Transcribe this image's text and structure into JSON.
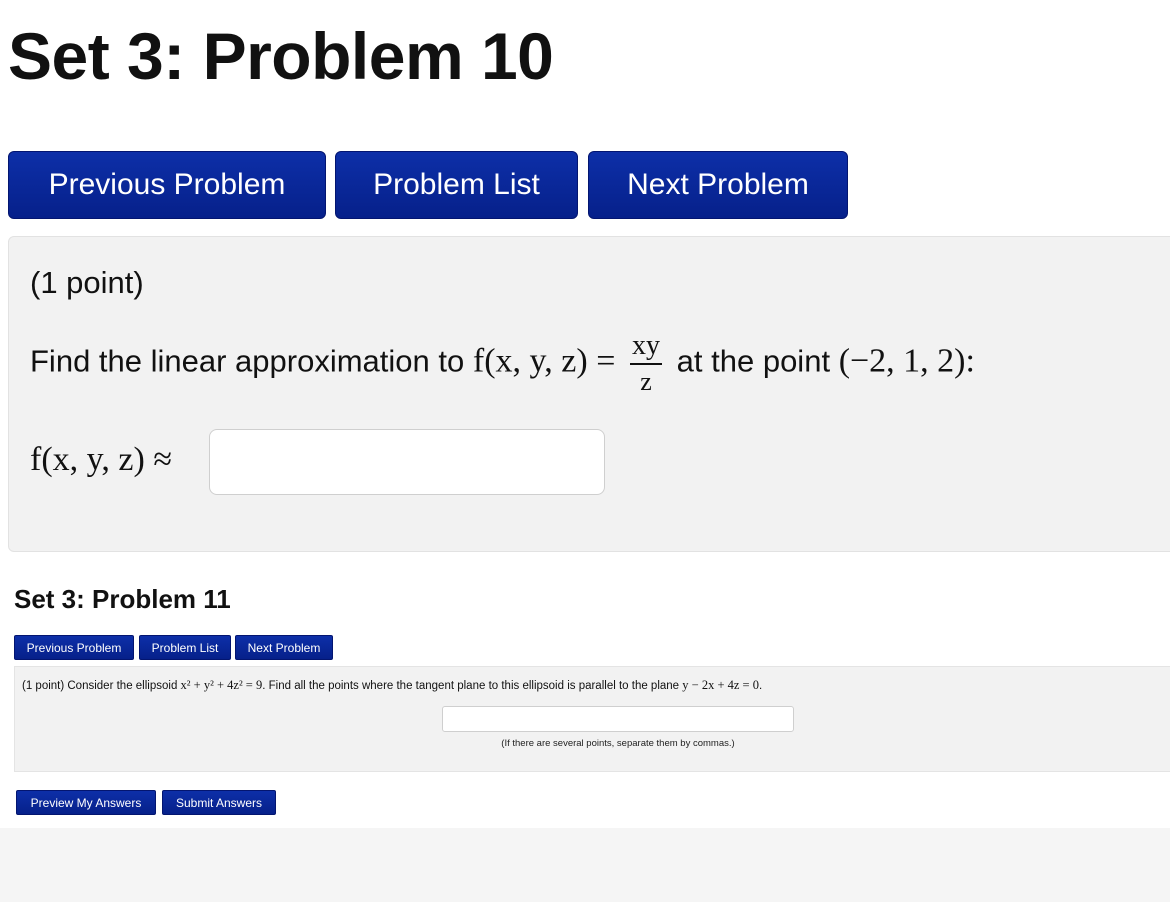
{
  "problem10": {
    "title": "Set 3: Problem 10",
    "nav": {
      "previous": "Previous Problem",
      "list": "Problem List",
      "next": "Next Problem"
    },
    "points": "(1 point)",
    "prompt_before": "Find the linear approximation to",
    "function_lhs": "f(x, y, z) =",
    "fraction_numerator": "xy",
    "fraction_denominator": "z",
    "prompt_after": "at the point",
    "point": "(−2, 1, 2):",
    "answer_label": "f(x, y, z) ≈",
    "answer_value": ""
  },
  "problem11": {
    "title": "Set 3: Problem 11",
    "nav": {
      "previous": "Previous Problem",
      "list": "Problem List",
      "next": "Next Problem"
    },
    "text_part1": "(1 point) Consider the ellipsoid",
    "ellipsoid_eq": "x² + y² + 4z² = 9",
    "text_part2": ". Find all the points where the tangent plane to this ellipsoid is parallel to the plane",
    "plane_eq": "y − 2x + 4z = 0",
    "text_end": ".",
    "answer_value": "",
    "hint": "(If there are several points, separate them by commas.)"
  },
  "actions": {
    "preview": "Preview My Answers",
    "submit": "Submit Answers"
  }
}
